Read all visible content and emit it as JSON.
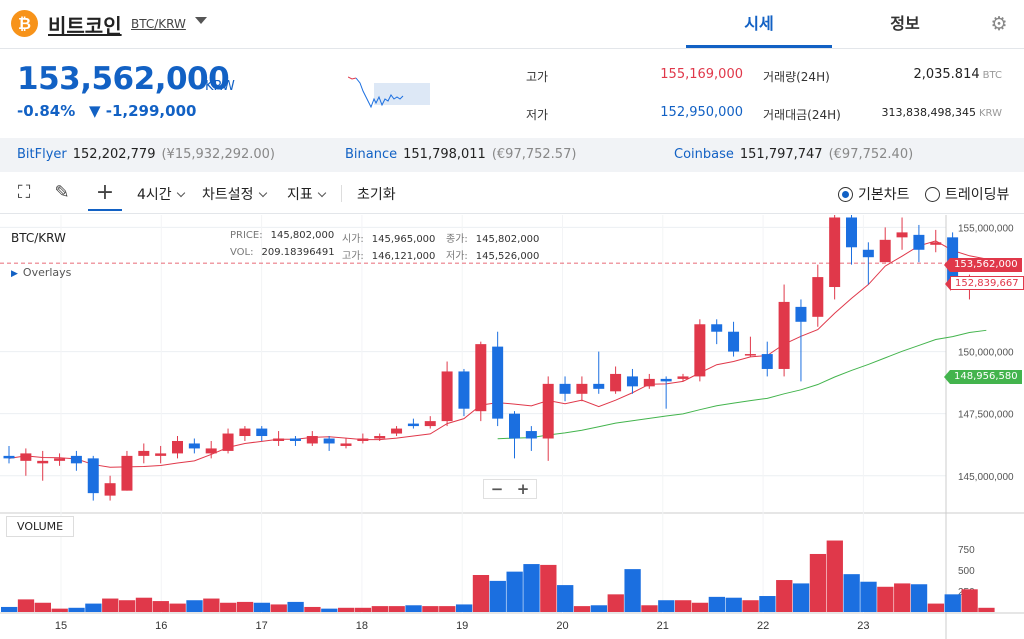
{
  "header": {
    "coin_logo": "₿",
    "coin_name": "비트코인",
    "pair": "BTC/KRW",
    "tabs": [
      {
        "label": "시세",
        "active": true
      },
      {
        "label": "정보",
        "active": false
      }
    ],
    "settings_icon": "gear-icon"
  },
  "summary": {
    "price": "153,562,000",
    "unit": "KRW",
    "change_pct": "-0.84%",
    "change_abs": "▼ -1,299,000",
    "high_label": "고가",
    "high": "155,169,000",
    "low_label": "저가",
    "low": "152,950,000",
    "volume_label": "거래량(24H)",
    "volume": "2,035.814",
    "volume_unit": "BTC",
    "amount_label": "거래대금(24H)",
    "amount": "313,838,498,345",
    "amount_unit": "KRW"
  },
  "exchanges": [
    {
      "name": "BitFlyer",
      "price": "152,202,779",
      "sub": "(¥15,932,292.00)"
    },
    {
      "name": "Binance",
      "price": "151,798,011",
      "sub": "(€97,752.57)"
    },
    {
      "name": "Coinbase",
      "price": "151,797,747",
      "sub": "(€97,752.40)"
    }
  ],
  "toolbar": {
    "interval": "4시간",
    "chart_settings": "차트설정",
    "indicators": "지표",
    "reset": "초기화",
    "basic_chart": "기본차트",
    "tradingview": "트레이딩뷰"
  },
  "chart": {
    "pair": "BTC/KRW",
    "overlays": "Overlays",
    "ohlc": {
      "price_label": "PRICE:",
      "price": "145,802,000",
      "open_label": "시가:",
      "open": "145,965,000",
      "close_label": "종가:",
      "close": "145,802,000",
      "vol_label": "VOL:",
      "vol": "209.18396491",
      "high_label": "고가:",
      "high": "146,121,000",
      "low_label": "저가:",
      "low": "145,526,000"
    },
    "zoom_out": "−",
    "zoom_in": "+",
    "volume_label": "VOLUME",
    "current_price_tag": "153,562,000",
    "ma_short_tag": "152,839,667",
    "ma_long_tag": "148,956,580",
    "colors": {
      "up": "#e0384a",
      "down": "#1b6fe0",
      "ma_short": "#e0384a",
      "ma_long": "#43b44d"
    }
  },
  "chart_data": {
    "type": "candlestick",
    "y_ticks": [
      145000000,
      147500000,
      150000000,
      155000000
    ],
    "y_tick_labels": [
      "145,000,000",
      "147,500,000",
      "150,000,000",
      "155,000,000"
    ],
    "ylim": [
      143500000,
      155500000
    ],
    "x_tick_labels": [
      "15",
      "16",
      "17",
      "18",
      "19",
      "20",
      "21",
      "22",
      "23"
    ],
    "volume_ticks": [
      250,
      500,
      750
    ],
    "candles": [
      [
        145800000,
        145700000,
        146200000,
        145500000
      ],
      [
        145600000,
        145900000,
        146100000,
        145000000
      ],
      [
        145500000,
        145600000,
        146000000,
        144800000
      ],
      [
        145600000,
        145700000,
        145900000,
        145400000
      ],
      [
        145800000,
        145500000,
        146000000,
        145200000
      ],
      [
        145700000,
        144300000,
        145800000,
        144000000
      ],
      [
        144200000,
        144700000,
        145000000,
        144000000
      ],
      [
        144400000,
        145800000,
        146000000,
        144400000
      ],
      [
        145800000,
        146000000,
        146300000,
        145500000
      ],
      [
        145800000,
        145900000,
        146200000,
        145500000
      ],
      [
        145900000,
        146400000,
        146600000,
        145700000
      ],
      [
        146300000,
        146100000,
        146500000,
        145900000
      ],
      [
        145900000,
        146100000,
        146400000,
        145700000
      ],
      [
        146000000,
        146700000,
        146900000,
        145900000
      ],
      [
        146600000,
        146900000,
        147000000,
        146400000
      ],
      [
        146900000,
        146600000,
        147000000,
        146400000
      ],
      [
        146400000,
        146500000,
        146800000,
        146200000
      ],
      [
        146500000,
        146400000,
        146600000,
        146200000
      ],
      [
        146300000,
        146600000,
        146800000,
        146200000
      ],
      [
        146500000,
        146300000,
        146600000,
        146000000
      ],
      [
        146200000,
        146300000,
        146500000,
        146100000
      ],
      [
        146400000,
        146500000,
        146700000,
        146300000
      ],
      [
        146500000,
        146600000,
        146700000,
        146400000
      ],
      [
        146700000,
        146900000,
        147000000,
        146600000
      ],
      [
        147100000,
        147000000,
        147300000,
        146900000
      ],
      [
        147000000,
        147200000,
        147400000,
        146900000
      ],
      [
        147200000,
        149200000,
        149600000,
        147000000
      ],
      [
        149200000,
        147700000,
        149300000,
        147400000
      ],
      [
        147600000,
        150300000,
        150400000,
        147200000
      ],
      [
        150200000,
        147300000,
        150800000,
        147000000
      ],
      [
        147500000,
        146500000,
        147600000,
        145700000
      ],
      [
        146800000,
        146500000,
        147000000,
        146000000
      ],
      [
        146500000,
        148700000,
        149000000,
        145600000
      ],
      [
        148700000,
        148300000,
        149000000,
        148000000
      ],
      [
        148300000,
        148700000,
        149000000,
        148000000
      ],
      [
        148700000,
        148500000,
        150000000,
        148300000
      ],
      [
        148400000,
        149100000,
        149400000,
        148300000
      ],
      [
        149000000,
        148600000,
        149300000,
        148300000
      ],
      [
        148600000,
        148900000,
        149100000,
        148500000
      ],
      [
        148900000,
        148800000,
        149000000,
        147700000
      ],
      [
        148900000,
        149000000,
        149100000,
        148800000
      ],
      [
        149000000,
        151100000,
        151300000,
        148800000
      ],
      [
        151100000,
        150800000,
        151300000,
        150300000
      ],
      [
        150800000,
        150000000,
        151200000,
        149800000
      ],
      [
        149900000,
        149900000,
        150600000,
        149800000
      ],
      [
        149900000,
        149300000,
        150400000,
        149000000
      ],
      [
        149300000,
        152000000,
        152700000,
        149000000
      ],
      [
        151800000,
        151200000,
        152100000,
        148800000
      ],
      [
        151400000,
        153000000,
        153500000,
        151000000
      ],
      [
        152600000,
        155400000,
        155500000,
        152100000
      ],
      [
        155400000,
        154200000,
        155500000,
        153500000
      ],
      [
        154100000,
        153800000,
        154400000,
        152700000
      ],
      [
        153600000,
        154500000,
        155000000,
        153600000
      ],
      [
        154600000,
        154800000,
        155400000,
        154100000
      ],
      [
        154700000,
        154100000,
        155100000,
        153600000
      ],
      [
        154300000,
        154400000,
        154900000,
        154000000
      ],
      [
        154600000,
        152700000,
        154800000,
        152600000
      ],
      [
        152500000,
        152700000,
        153100000,
        152100000
      ],
      [
        152700000,
        152900000,
        153000000,
        152600000
      ]
    ],
    "volumes": [
      60,
      150,
      110,
      40,
      50,
      100,
      160,
      140,
      170,
      130,
      100,
      140,
      160,
      110,
      120,
      110,
      90,
      120,
      60,
      40,
      50,
      50,
      70,
      70,
      80,
      70,
      70,
      90,
      440,
      370,
      480,
      570,
      560,
      320,
      70,
      80,
      210,
      510,
      80,
      140,
      140,
      110,
      180,
      170,
      140,
      190,
      380,
      340,
      690,
      850,
      450,
      360,
      300,
      340,
      330,
      100,
      210,
      270,
      50
    ]
  }
}
